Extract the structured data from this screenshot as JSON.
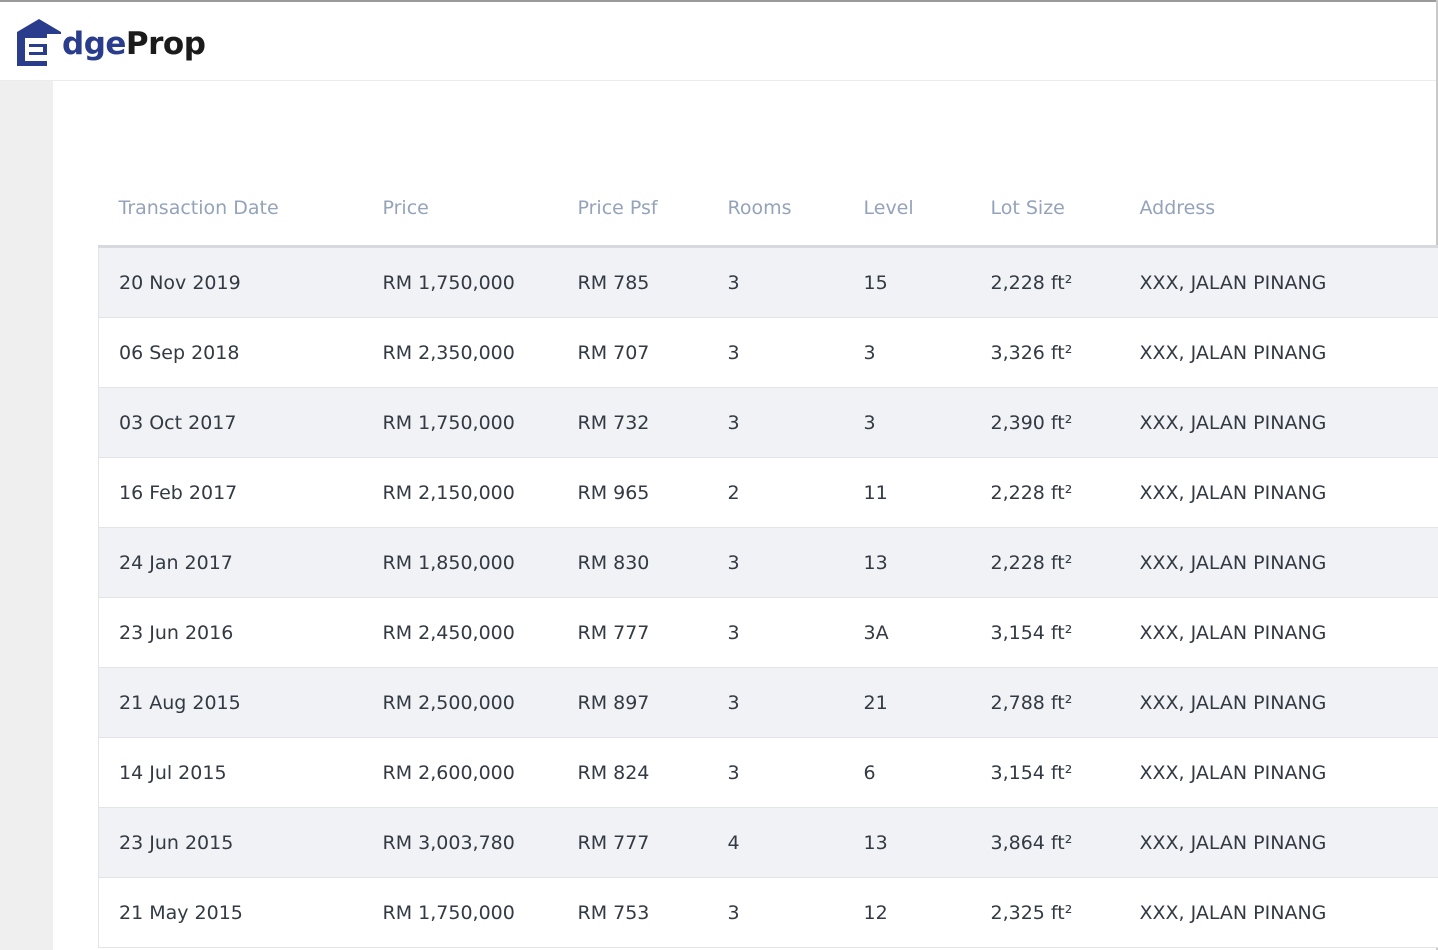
{
  "brand": {
    "name_part1": "dge",
    "name_part2": "Prop",
    "full_name": "EdgeProp",
    "colors": {
      "primary": "#2a3c8c",
      "dark": "#1b1b1b"
    }
  },
  "table": {
    "columns": [
      "Transaction Date",
      "Price",
      "Price Psf",
      "Rooms",
      "Level",
      "Lot Size",
      "Address"
    ],
    "rows": [
      [
        "20 Nov 2019",
        "RM 1,750,000",
        "RM 785",
        "3",
        "15",
        "2,228 ft²",
        "XXX, JALAN PINANG"
      ],
      [
        "06 Sep 2018",
        "RM 2,350,000",
        "RM 707",
        "3",
        "3",
        "3,326 ft²",
        "XXX, JALAN PINANG"
      ],
      [
        "03 Oct 2017",
        "RM 1,750,000",
        "RM 732",
        "3",
        "3",
        "2,390 ft²",
        "XXX, JALAN PINANG"
      ],
      [
        "16 Feb 2017",
        "RM 2,150,000",
        "RM 965",
        "2",
        "11",
        "2,228 ft²",
        "XXX, JALAN PINANG"
      ],
      [
        "24 Jan 2017",
        "RM 1,850,000",
        "RM 830",
        "3",
        "13",
        "2,228 ft²",
        "XXX, JALAN PINANG"
      ],
      [
        "23 Jun 2016",
        "RM 2,450,000",
        "RM 777",
        "3",
        "3A",
        "3,154 ft²",
        "XXX, JALAN PINANG"
      ],
      [
        "21 Aug 2015",
        "RM 2,500,000",
        "RM 897",
        "3",
        "21",
        "2,788 ft²",
        "XXX, JALAN PINANG"
      ],
      [
        "14 Jul 2015",
        "RM 2,600,000",
        "RM 824",
        "3",
        "6",
        "3,154 ft²",
        "XXX, JALAN PINANG"
      ],
      [
        "23 Jun 2015",
        "RM 3,003,780",
        "RM 777",
        "4",
        "13",
        "3,864 ft²",
        "XXX, JALAN PINANG"
      ],
      [
        "21 May 2015",
        "RM 1,750,000",
        "RM 753",
        "3",
        "12",
        "2,325 ft²",
        "XXX, JALAN PINANG"
      ]
    ]
  }
}
